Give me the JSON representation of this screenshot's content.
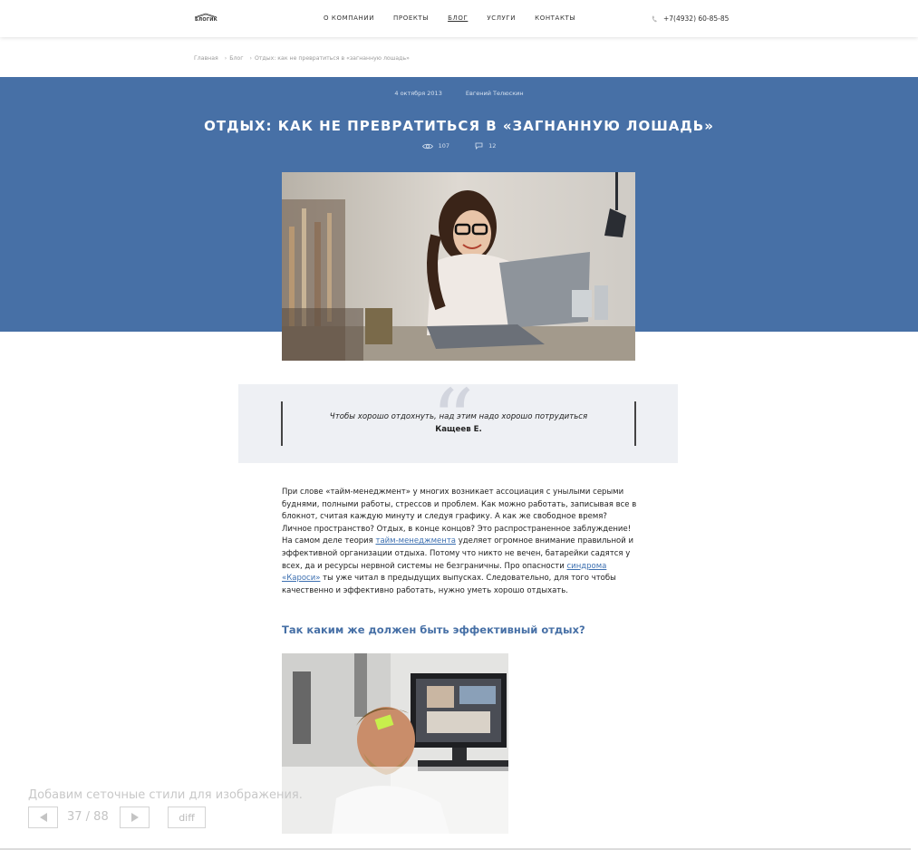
{
  "header": {
    "logo_text": "БЛОГИК",
    "nav": [
      "О КОМПАНИИ",
      "ПРОЕКТЫ",
      "БЛОГ",
      "УСЛУГИ",
      "КОНТАКТЫ"
    ],
    "active_nav": "БЛОГ",
    "phone": "+7(4932) 60-85-85"
  },
  "breadcrumbs": [
    "Главная",
    "Блог",
    "Отдых: как не превратиться в «загнанную лошадь»"
  ],
  "post": {
    "date": "4 октября 2013",
    "author": "Евгений Телюскин",
    "title": "ОТДЫХ: КАК НЕ ПРЕВРАТИТЬСЯ В «ЗАГНАННУЮ ЛОШАДЬ»",
    "views": "107",
    "comments": "12"
  },
  "quote": {
    "text": "Чтобы хорошо отдохнуть, над этим надо хорошо потрудиться",
    "author": "Кащеев Е."
  },
  "article": {
    "p1_a": "При слове «тайм-менеджмент» у многих возникает ассоциация с унылыми серыми буднями, полными работы, стрессов и проблем. Как можно работать, записывая все в блокнот, считая каждую минуту и следуя графику. А как же свободное время? Личное пространство? Отдых, в конце концов? Это распространенное заблуждение! На самом деле теория ",
    "link1": "тайм-менеджмента",
    "p1_b": " уделяет огромное внимание правильной и эффективной организации отдыха. Потому что никто не вечен, батарейки садятся у всех, да и ресурсы нервной системы не безграничны. Про опасности ",
    "link2": "синдрома «Кароси»",
    "p1_c": " ты уже читал в предыдущих выпусках. Следовательно, для того чтобы качественно и эффективно работать, нужно уметь хорошо отдыхать.",
    "heading": "Так каким же должен быть эффективный отдых?"
  },
  "overlay": {
    "caption": "Добавим сеточные стили для изображения.",
    "counter": "37 / 88",
    "prev_icon": "left-triangle-icon",
    "next_icon": "right-triangle-icon",
    "diff_label": "diff"
  },
  "colors": {
    "hero_bg": "#4770a6",
    "link": "#3c6fb0",
    "quote_bg": "#eef0f4"
  }
}
